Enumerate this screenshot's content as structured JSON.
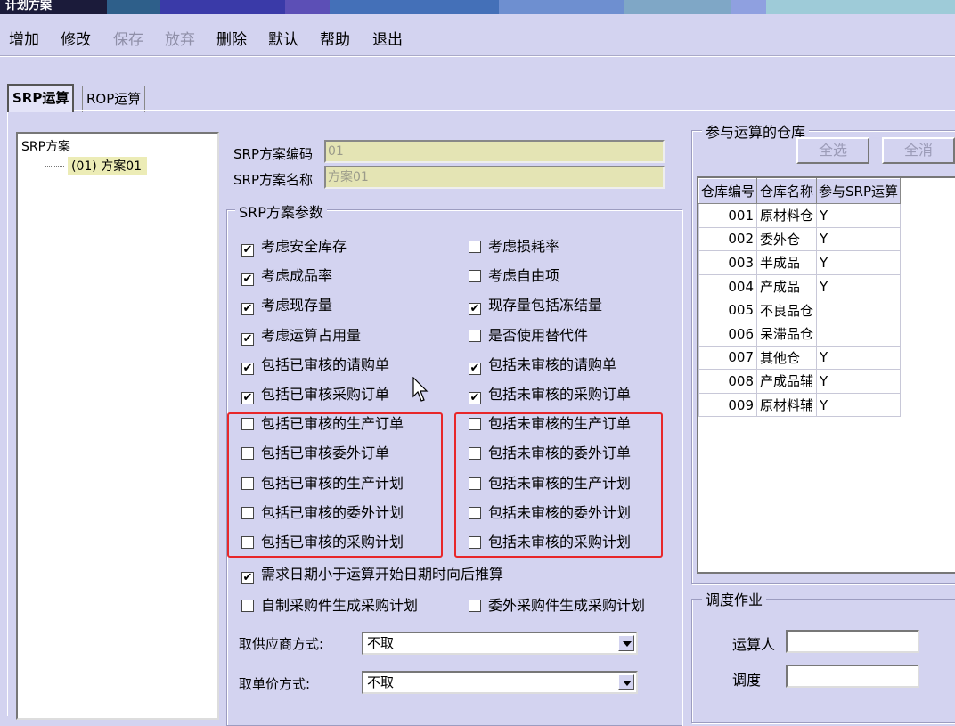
{
  "window": {
    "title": "计划方案"
  },
  "toolbar": {
    "add": "增加",
    "edit": "修改",
    "save": "保存",
    "discard": "放弃",
    "delete": "删除",
    "default": "默认",
    "help": "帮助",
    "exit": "退出"
  },
  "tabs": [
    {
      "label": "SRP运算"
    },
    {
      "label": "ROP运算"
    }
  ],
  "tree": {
    "root": "SRP方案",
    "child": "(01) 方案01"
  },
  "scheme": {
    "code_label": "SRP方案编码",
    "code_value": "01",
    "name_label": "SRP方案名称",
    "name_value": "方案01"
  },
  "params": {
    "title": "SRP方案参数",
    "left": [
      {
        "label": "考虑安全库存",
        "checked": true
      },
      {
        "label": "考虑成品率",
        "checked": true
      },
      {
        "label": "考虑现存量",
        "checked": true
      },
      {
        "label": "考虑运算占用量",
        "checked": true
      },
      {
        "label": "包括已审核的请购单",
        "checked": true
      },
      {
        "label": "包括已审核采购订单",
        "checked": true
      },
      {
        "label": "包括已审核的生产订单",
        "checked": false
      },
      {
        "label": "包括已审核委外订单",
        "checked": false
      },
      {
        "label": "包括已审核的生产计划",
        "checked": false
      },
      {
        "label": "包括已审核的委外计划",
        "checked": false
      },
      {
        "label": "包括已审核的采购计划",
        "checked": false
      }
    ],
    "right": [
      {
        "label": "考虑损耗率",
        "checked": false
      },
      {
        "label": "考虑自由项",
        "checked": false
      },
      {
        "label": "现存量包括冻结量",
        "checked": true
      },
      {
        "label": "是否使用替代件",
        "checked": false
      },
      {
        "label": "包括未审核的请购单",
        "checked": true
      },
      {
        "label": "包括未审核的采购订单",
        "checked": true
      },
      {
        "label": "包括未审核的生产订单",
        "checked": false
      },
      {
        "label": "包括未审核的委外订单",
        "checked": false
      },
      {
        "label": "包括未审核的生产计划",
        "checked": false
      },
      {
        "label": "包括未审核的委外计划",
        "checked": false
      },
      {
        "label": "包括未审核的采购计划",
        "checked": false
      }
    ],
    "backward": {
      "label": "需求日期小于运算开始日期时向后推算",
      "checked": true
    },
    "selfmade": {
      "label": "自制采购件生成采购计划",
      "checked": false
    },
    "outsource": {
      "label": "委外采购件生成采购计划",
      "checked": false
    },
    "supplier_label": "取供应商方式:",
    "supplier_value": "不取",
    "price_label": "取单价方式:",
    "price_value": "不取"
  },
  "warehouse": {
    "title": "参与运算的仓库",
    "select_all": "全选",
    "deselect_all": "全消",
    "headers": [
      "仓库编号",
      "仓库名称",
      "参与SRP运算"
    ],
    "rows": [
      [
        "001",
        "原材料仓",
        "Y"
      ],
      [
        "002",
        "委外仓",
        "Y"
      ],
      [
        "003",
        "半成品",
        "Y"
      ],
      [
        "004",
        "产成品",
        "Y"
      ],
      [
        "005",
        "不良品仓",
        ""
      ],
      [
        "006",
        "呆滞品仓",
        ""
      ],
      [
        "007",
        "其他仓",
        "Y"
      ],
      [
        "008",
        "产成品辅",
        "Y"
      ],
      [
        "009",
        "原材料辅",
        "Y"
      ]
    ]
  },
  "schedule": {
    "title": "调度作业",
    "operator_label": "运算人",
    "schedule_label": "调度"
  }
}
